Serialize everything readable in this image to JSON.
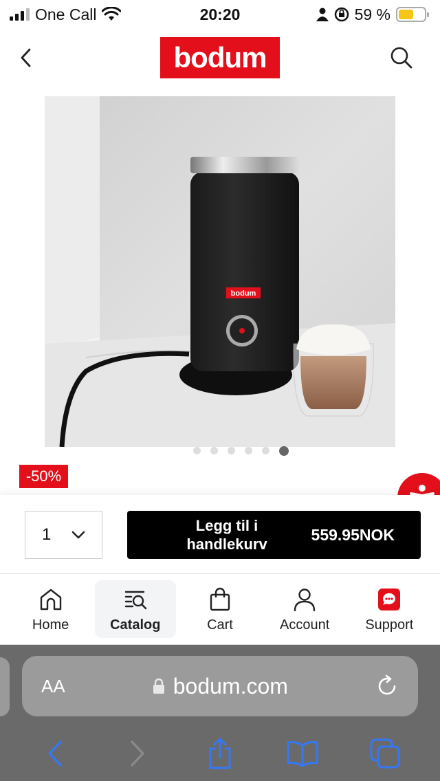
{
  "status_bar": {
    "carrier": "One Call",
    "time": "20:20",
    "battery_percent": "59 %",
    "battery_level": 0.59
  },
  "header": {
    "logo_text": "bodum",
    "back_icon": "chevron-left-icon",
    "search_icon": "search-icon"
  },
  "product": {
    "image_dots": {
      "count": 6,
      "active_index": 5
    },
    "discount_badge": "-50%"
  },
  "purchase": {
    "quantity": "1",
    "add_to_cart_label": "Legg til i handlekurv",
    "price": "559.95NOK"
  },
  "bottom_nav": {
    "items": [
      {
        "label": "Home",
        "icon": "home-icon"
      },
      {
        "label": "Catalog",
        "icon": "catalog-icon",
        "active": true
      },
      {
        "label": "Cart",
        "icon": "shopping-bag-icon"
      },
      {
        "label": "Account",
        "icon": "user-icon"
      },
      {
        "label": "Support",
        "icon": "chat-icon"
      }
    ]
  },
  "browser": {
    "text_size_label": "AA",
    "url": "bodum.com"
  },
  "colors": {
    "brand_red": "#e3101b",
    "button_black": "#000000",
    "safari_gray": "#6a6a6a",
    "ios_blue": "#3478f6"
  }
}
